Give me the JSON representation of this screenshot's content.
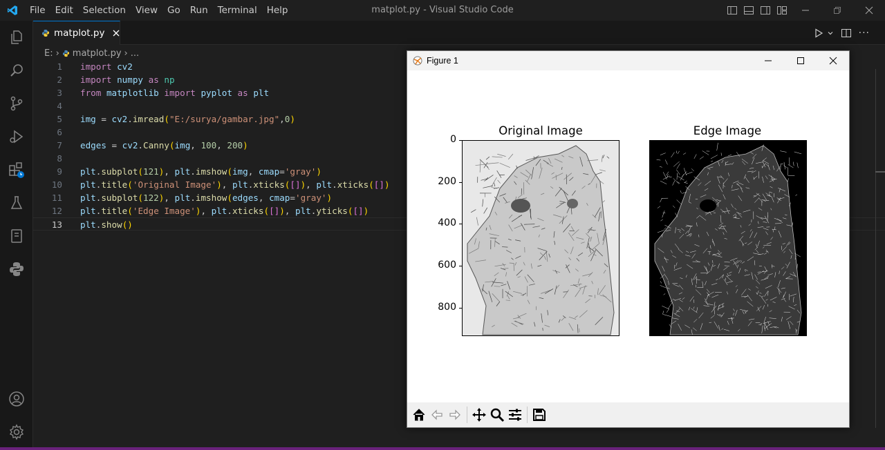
{
  "titlebar": {
    "menu": [
      "File",
      "Edit",
      "Selection",
      "View",
      "Go",
      "Run",
      "Terminal",
      "Help"
    ],
    "window_title": "matplot.py - Visual Studio Code",
    "icons": [
      "vscode-logo",
      "toggle-primary-sidebar",
      "toggle-panel",
      "toggle-secondary-sidebar",
      "customize-layout",
      "minimize",
      "restore",
      "close"
    ]
  },
  "activitybar": {
    "items": [
      "explorer",
      "search",
      "source-control",
      "run-and-debug",
      "extensions",
      "testing",
      "notebooks",
      "python"
    ],
    "bottom": [
      "accounts",
      "manage"
    ]
  },
  "tabs": [
    {
      "label": "matplot.py",
      "active": true,
      "icon": "python-file-icon"
    }
  ],
  "breadcrumb": {
    "drive": "E:",
    "file": "matplot.py",
    "more": "..."
  },
  "editor": {
    "current_line": 13,
    "lines": [
      "import cv2",
      "import numpy as np",
      "from matplotlib import pyplot as plt",
      "",
      "img = cv2.imread(\"E:/surya/gambar.jpg\",0)",
      "",
      "edges = cv2.Canny(img, 100, 200)",
      "",
      "plt.subplot(121), plt.imshow(img, cmap='gray')",
      "plt.title('Original Image'), plt.xticks([]), plt.xticks([])",
      "plt.subplot(122), plt.imshow(edges, cmap='gray')",
      "plt.title('Edge Image'), plt.xticks([]), plt.yticks([])",
      "plt.show()"
    ]
  },
  "figure": {
    "title": "Figure 1",
    "toolbar": [
      "home",
      "back",
      "forward",
      "pan",
      "zoom",
      "configure-subplots",
      "save"
    ],
    "axes": [
      {
        "title": "Original Image",
        "yticks": [
          "0",
          "200",
          "400",
          "600",
          "800"
        ],
        "image": "grayscale pencil sketch"
      },
      {
        "title": "Edge Image",
        "yticks": [],
        "image": "canny edge map"
      }
    ]
  },
  "chart_data": [
    {
      "type": "image",
      "title": "Original Image",
      "ytick_values": [
        0,
        200,
        400,
        600,
        800
      ],
      "ylim": [
        935,
        0
      ],
      "xticks": []
    },
    {
      "type": "image",
      "title": "Edge Image",
      "ytick_values": [],
      "xticks": []
    }
  ],
  "colors": {
    "accent": "#0078d4",
    "status": "#68217a",
    "editor_bg": "#1f1f1f"
  }
}
